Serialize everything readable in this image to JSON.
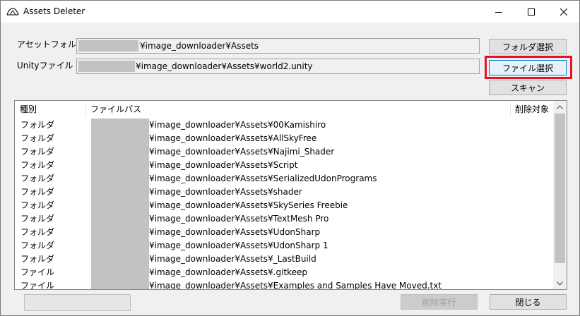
{
  "window": {
    "title": "Assets Deleter",
    "min_symbol": "—",
    "max_symbol": "☐",
    "close_symbol": "✕"
  },
  "form": {
    "asset_folder_label": "アセットフォルダ",
    "asset_folder_value": "¥image_downloader¥Assets",
    "unity_file_label": "Unityファイル",
    "unity_file_value": "¥image_downloader¥Assets¥world2.unity",
    "folder_select_button": "フォルダ選択",
    "file_select_button": "ファイル選択",
    "scan_button": "スキャン"
  },
  "list": {
    "columns": [
      "種別",
      "ファイルパス",
      "削除対象"
    ],
    "rows": [
      {
        "kind": "フォルダ",
        "path": "¥image_downloader¥Assets¥00Kamishiro"
      },
      {
        "kind": "フォルダ",
        "path": "¥image_downloader¥Assets¥AllSkyFree"
      },
      {
        "kind": "フォルダ",
        "path": "¥image_downloader¥Assets¥Najimi_Shader"
      },
      {
        "kind": "フォルダ",
        "path": "¥image_downloader¥Assets¥Script"
      },
      {
        "kind": "フォルダ",
        "path": "¥image_downloader¥Assets¥SerializedUdonPrograms"
      },
      {
        "kind": "フォルダ",
        "path": "¥image_downloader¥Assets¥shader"
      },
      {
        "kind": "フォルダ",
        "path": "¥image_downloader¥Assets¥SkySeries Freebie"
      },
      {
        "kind": "フォルダ",
        "path": "¥image_downloader¥Assets¥TextMesh Pro"
      },
      {
        "kind": "フォルダ",
        "path": "¥image_downloader¥Assets¥UdonSharp"
      },
      {
        "kind": "フォルダ",
        "path": "¥image_downloader¥Assets¥UdonSharp 1"
      },
      {
        "kind": "フォルダ",
        "path": "¥image_downloader¥Assets¥_LastBuild"
      },
      {
        "kind": "ファイル",
        "path": "¥image_downloader¥Assets¥.gitkeep"
      },
      {
        "kind": "ファイル",
        "path": "¥image_downloader¥Assets¥Examples and Samples Have Moved.txt"
      }
    ]
  },
  "footer": {
    "delete_button": "削除実行",
    "close_button": "閉じる"
  },
  "colors": {
    "highlight": "#e81123",
    "window_bg": "#f0f0f0",
    "redaction": "#c2c2c2"
  }
}
